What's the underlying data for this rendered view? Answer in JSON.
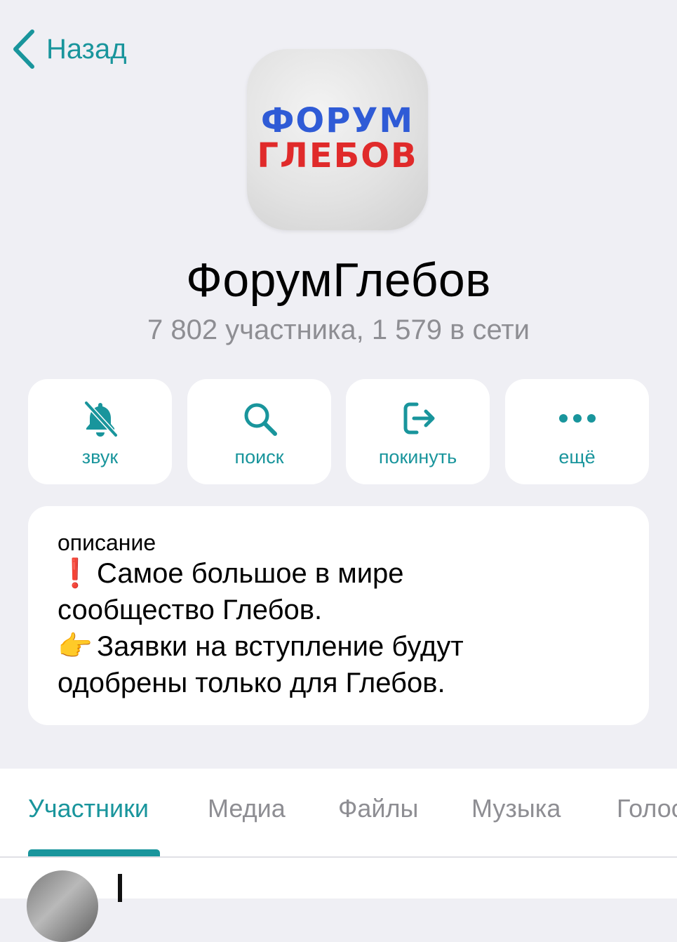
{
  "nav": {
    "back_label": "Назад"
  },
  "avatar": {
    "logo_line1": "ФОРУМ",
    "logo_line2": "ГЛЕБОВ"
  },
  "group": {
    "title": "ФорумГлебов",
    "subtitle": "7 802 участника, 1 579 в сети"
  },
  "actions": [
    {
      "label": "звук",
      "icon": "bell-slash-icon"
    },
    {
      "label": "поиск",
      "icon": "search-icon"
    },
    {
      "label": "покинуть",
      "icon": "leave-icon"
    },
    {
      "label": "ещё",
      "icon": "ellipsis-icon"
    }
  ],
  "description": {
    "label": "описание",
    "line1_emoji": "❗",
    "line1": "Самое большое в мире",
    "line2": "сообщество Глебов.",
    "line3_emoji": "👉",
    "line3": "Заявки на вступление будут",
    "line4": "одобрены только для Глебов."
  },
  "tabs": [
    {
      "label": "Участники",
      "active": true
    },
    {
      "label": "Медиа"
    },
    {
      "label": "Файлы"
    },
    {
      "label": "Музыка"
    },
    {
      "label": "Голос"
    }
  ],
  "colors": {
    "accent": "#19959c",
    "background": "#efeff4",
    "secondary_text": "#8e8e93"
  }
}
